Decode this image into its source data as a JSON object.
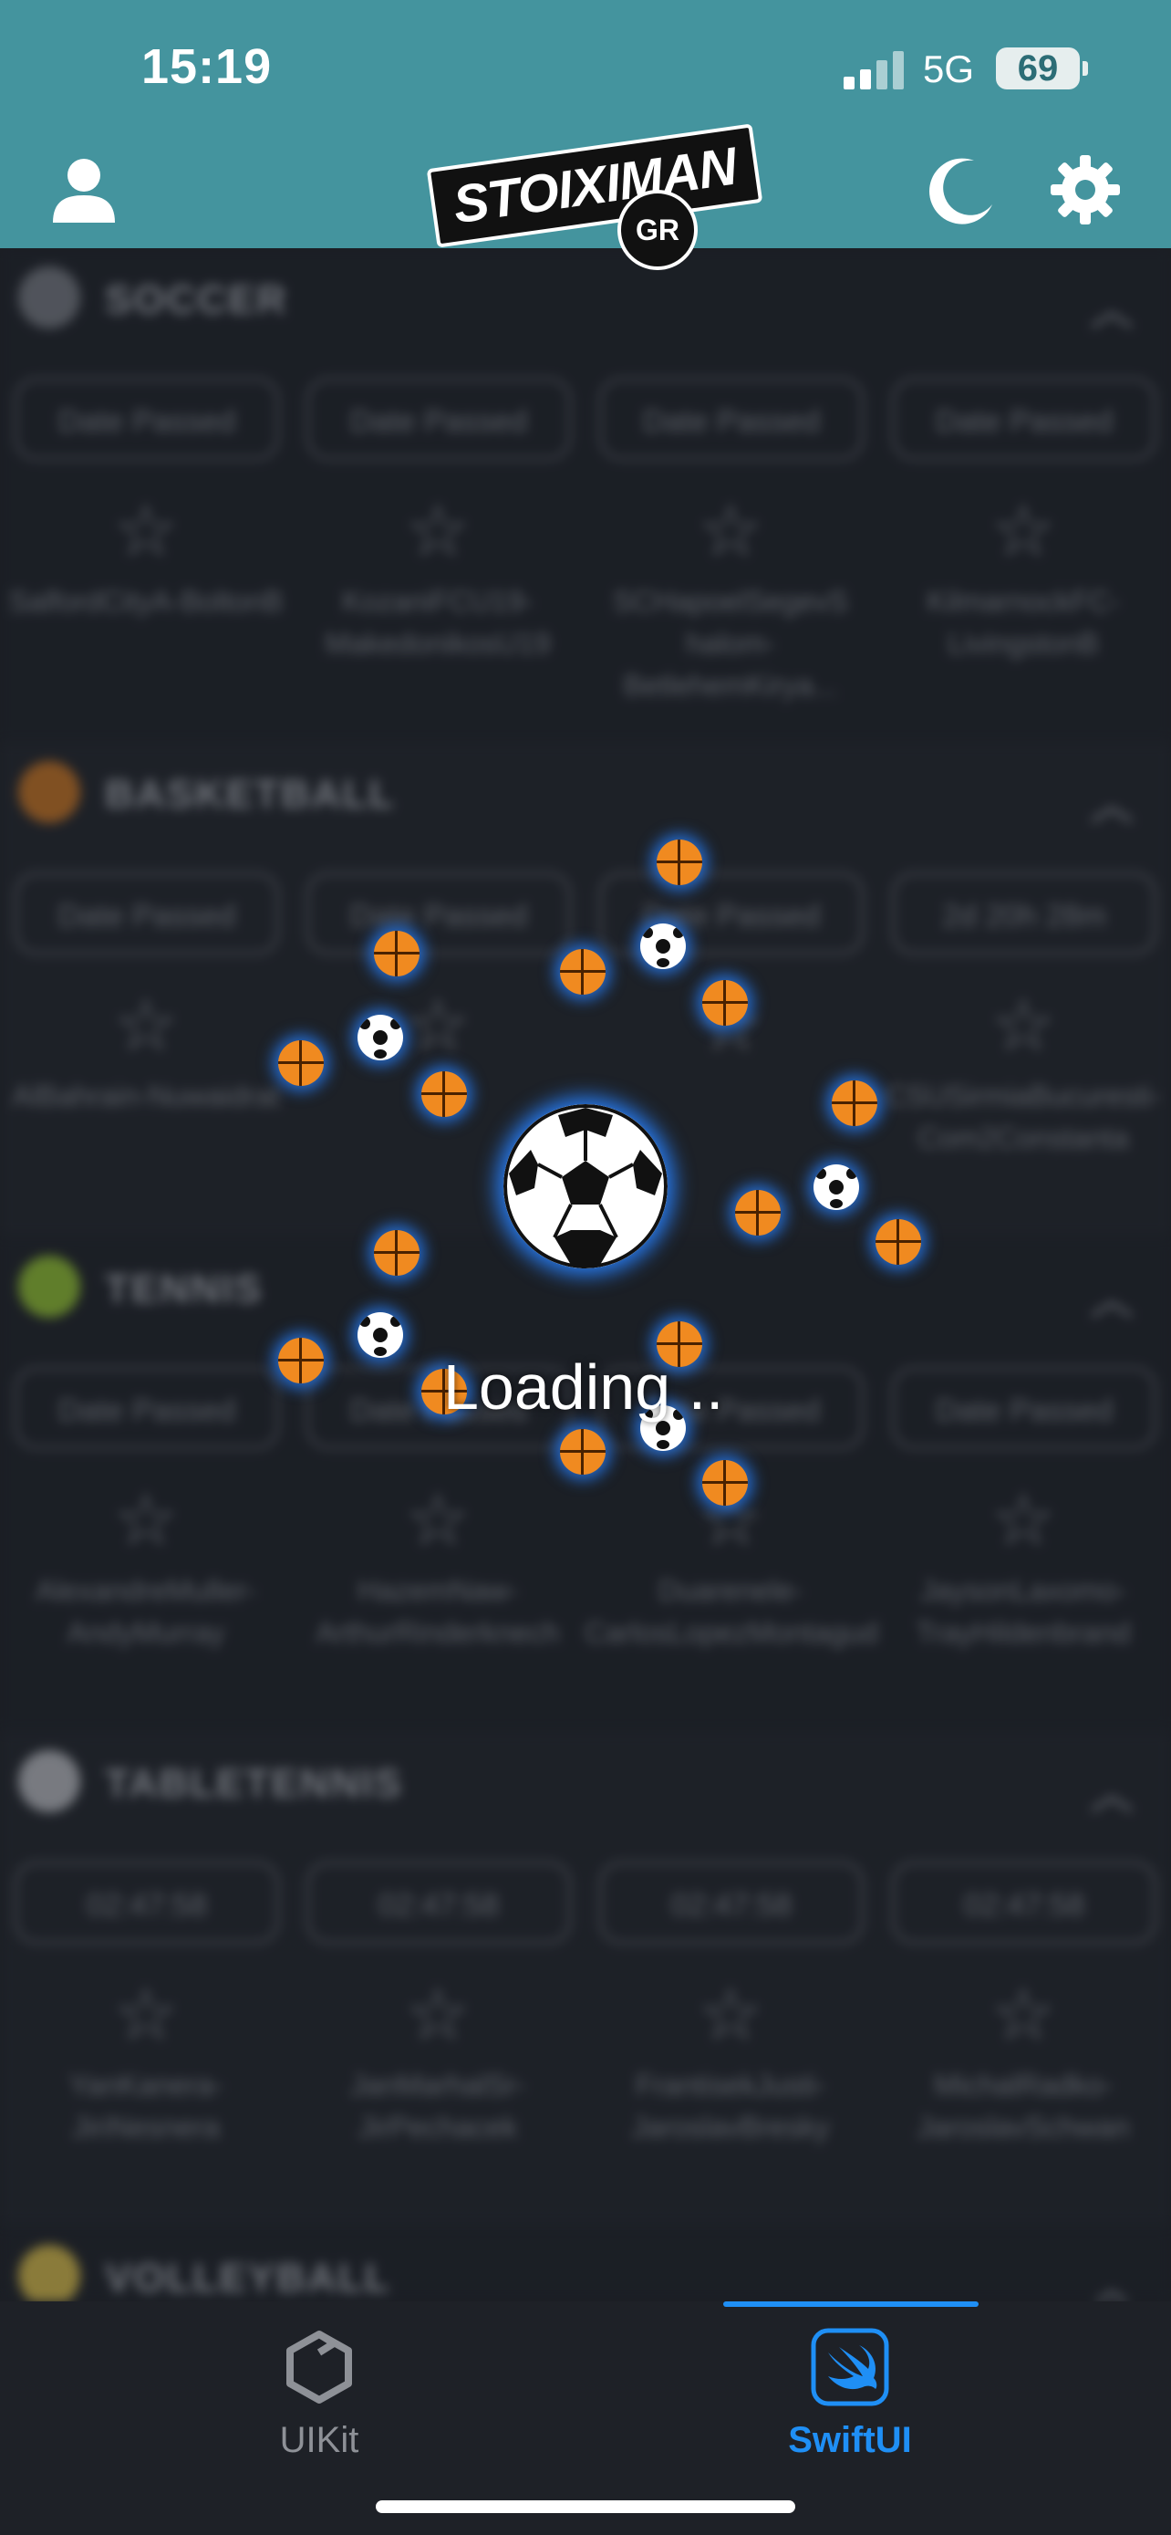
{
  "status_bar": {
    "time": "15:19",
    "network": "5G",
    "battery": "69"
  },
  "header": {
    "logo_text": "STOIXIMAN",
    "logo_region": "GR"
  },
  "sections": [
    {
      "title": "SOCCER",
      "icon": "soccer-player-icon",
      "icon_color": "#7c8088",
      "chips": [
        "Date Passed",
        "Date Passed",
        "Date Passed",
        "Date Passed"
      ],
      "events": [
        "SalfordCityA-BoltonB",
        "KozaniFCU19-MakedonikosU19",
        "SCHapoelSegevS halom-BetlehemKirya...",
        "KilmarnockFC-LivingstonB"
      ]
    },
    {
      "title": "BASKETBALL",
      "icon": "basketball-icon",
      "icon_color": "#d47a22",
      "chips": [
        "Date Passed",
        "Date Passed",
        "Date Passed",
        "2d 20h 28m"
      ],
      "events": [
        "AlBahrain-Nuwaidrat",
        "",
        "",
        "CSUSirmiaBucuresti-Com2Constanta"
      ]
    },
    {
      "title": "TENNIS",
      "icon": "tennis-ball-icon",
      "icon_color": "#9acd32",
      "chips": [
        "Date Passed",
        "Date Passed",
        "Date Passed",
        "Date Passed"
      ],
      "events": [
        "AlexandreMuller-AndyMurray",
        "HazemNaw-ArthurRinderknech",
        "Duarenele-CarlosLopezMontagud",
        "JaysonLaxomo-TrayHildenbrand"
      ]
    },
    {
      "title": "TABLETENNIS",
      "icon": "table-tennis-icon",
      "icon_color": "#c4c6cc",
      "chips": [
        "02:47:58",
        "02:47:58",
        "02:47:58",
        "02:47:58"
      ],
      "events": [
        "YanKanera-JiriNesnera",
        "JanMarhalSr-JirPechacek",
        "FrantisekJusti-JaroslavBresky",
        "MichalRadko-JaroslavSchwan"
      ]
    },
    {
      "title": "VOLLEYBALL",
      "icon": "volleyball-icon",
      "icon_color": "#e6c84c",
      "chips": [],
      "events": []
    }
  ],
  "loading": {
    "text": "Loading .."
  },
  "tabs": [
    {
      "label": "UIKit",
      "icon": "uikit-cube-icon",
      "color": "#8e9197",
      "selected": false
    },
    {
      "label": "SwiftUI",
      "icon": "swift-icon",
      "color": "#1f8ff5",
      "selected": true
    }
  ],
  "colors": {
    "header_bg": "#44949e",
    "background": "#1b1e24",
    "accent": "#1f8ff5",
    "basketball": "#f08a20"
  }
}
